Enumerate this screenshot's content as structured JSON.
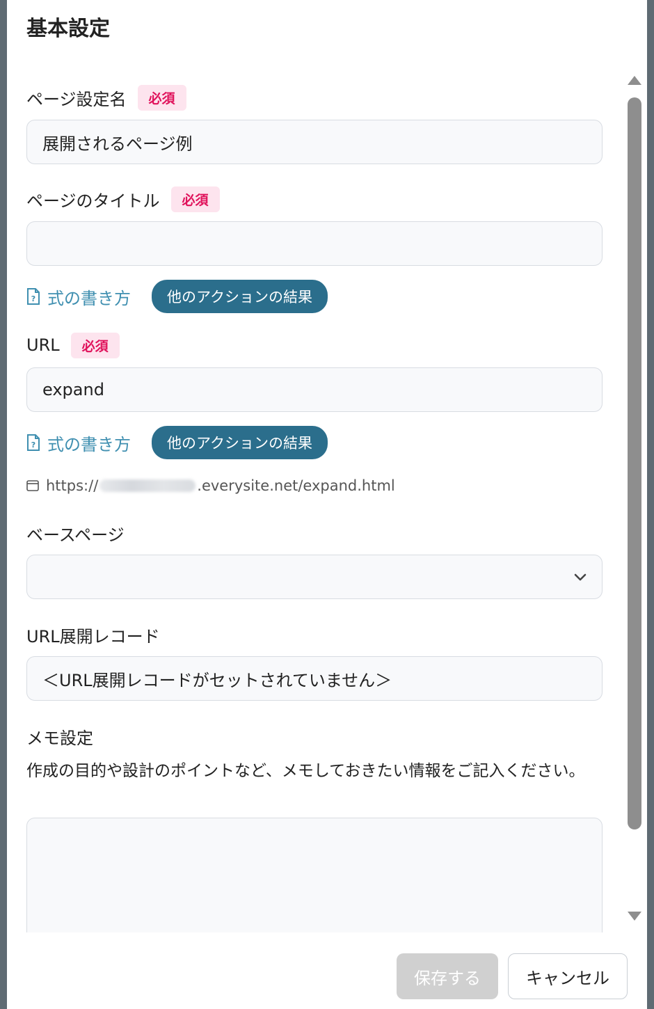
{
  "dialog": {
    "title": "基本設定"
  },
  "fields": {
    "page_setting_name": {
      "label": "ページ設定名",
      "required": "必須",
      "value": "展開されるページ例"
    },
    "page_title": {
      "label": "ページのタイトル",
      "required": "必須",
      "value": ""
    },
    "formula_link": "式の書き方",
    "other_action_results": "他のアクションの結果",
    "url": {
      "label": "URL",
      "required": "必須",
      "value": "expand"
    },
    "url_preview": {
      "prefix": "https://",
      "suffix": ".everysite.net/expand.html"
    },
    "base_page": {
      "label": "ベースページ",
      "value": ""
    },
    "url_expand_record": {
      "label": "URL展開レコード",
      "value": "＜URL展開レコードがセットされていません＞"
    },
    "memo": {
      "label": "メモ設定",
      "help": "作成の目的や設計のポイントなど、メモしておきたい情報をご記入ください。",
      "value": ""
    }
  },
  "footer": {
    "save_label": "保存する",
    "cancel_label": "キャンセル"
  },
  "colors": {
    "required_bg": "#fde4ee",
    "required_text": "#e0125b",
    "link": "#3f8fb0",
    "action_pill": "#2b6e8c",
    "save_disabled": "#d0d0d0"
  },
  "icons": {
    "formula": "doc-question-icon",
    "url_preview": "browser-window-icon",
    "select": "chevron-down-icon"
  }
}
